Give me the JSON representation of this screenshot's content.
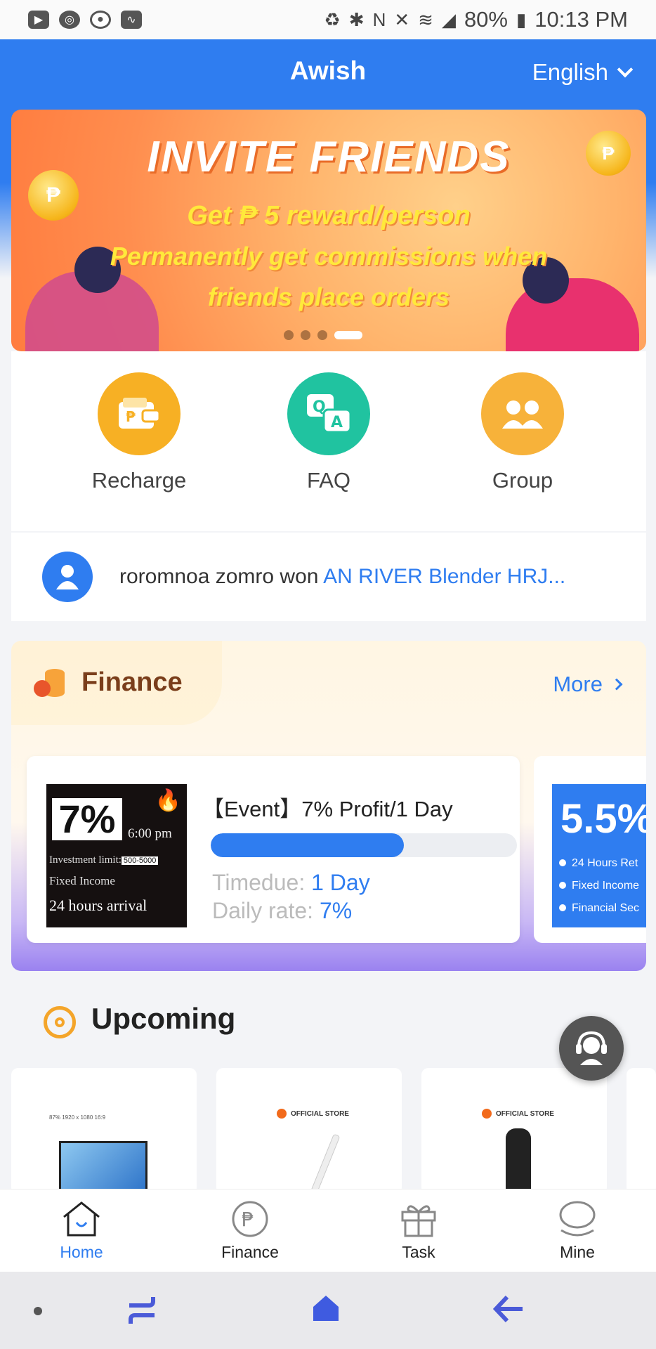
{
  "status_bar": {
    "icons": [
      "youtube-icon",
      "chrome-icon",
      "sync-icon",
      "activity-icon",
      "recycle-icon",
      "bluetooth-icon",
      "nfc-icon",
      "mute-icon",
      "wifi-icon",
      "signal-icon",
      "battery-icon"
    ],
    "battery": "80%",
    "time": "10:13 PM"
  },
  "header": {
    "title": "Awish",
    "language": "English"
  },
  "banner": {
    "title": "INVITE FRIENDS",
    "line1": "Get ₱ 5 reward/person",
    "line2": "Permanently get commissions when",
    "line3": "friends place orders",
    "coin_symbol": "₱"
  },
  "actions": [
    {
      "label": "Recharge",
      "icon": "wallet-icon"
    },
    {
      "label": "FAQ",
      "icon": "qa-icon"
    },
    {
      "label": "Group",
      "icon": "group-icon"
    }
  ],
  "ticker": {
    "user": "roromnoa zomro won ",
    "item": "AN RIVER Blender HRJ..."
  },
  "finance": {
    "title": "Finance",
    "more": "More",
    "card": {
      "thumb_pct": "7%",
      "thumb_time": "6:00 pm",
      "thumb_limit": "Investment limit:",
      "thumb_range": "500-5000",
      "thumb_fixed": "Fixed Income",
      "thumb_arrival": "24 hours arrival",
      "title": "【Event】7% Profit/1 Day",
      "progress": 0.63,
      "timedue_label": "Timedue: ",
      "timedue_value": "1 Day",
      "rate_label": "Daily rate: ",
      "rate_value": "7%"
    },
    "card2": {
      "big": "5.5%",
      "l1": "24 Hours Ret",
      "l2": "Fixed Income",
      "l3": "Financial Sec"
    }
  },
  "upcoming": {
    "title": "Upcoming",
    "products": [
      {
        "specs": "87%   1920 x 1080   16:9"
      },
      {
        "store": "OFFICIAL STORE"
      },
      {
        "store": "OFFICIAL STORE"
      }
    ]
  },
  "bottom_nav": [
    {
      "label": "Home",
      "active": true
    },
    {
      "label": "Finance",
      "active": false
    },
    {
      "label": "Task",
      "active": false
    },
    {
      "label": "Mine",
      "active": false
    }
  ],
  "colors": {
    "primary": "#2f7df0",
    "finance_title": "#7a3e1b",
    "orange": "#f7b024",
    "green": "#20c3a0"
  }
}
